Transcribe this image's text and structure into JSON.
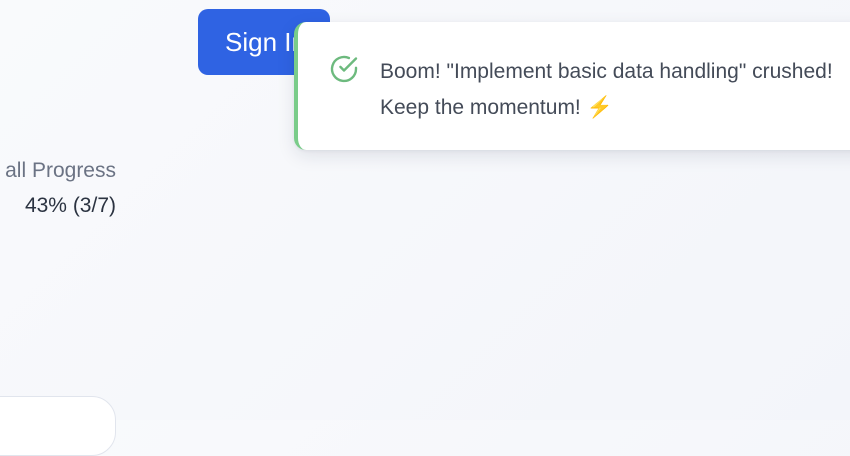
{
  "header": {
    "signin_label": "Sign In"
  },
  "progress": {
    "label": "all Progress",
    "value": "43% (3/7)"
  },
  "toast": {
    "message": "Boom! \"Implement basic data handling\" crushed! Keep the momentum! ",
    "emoji": "⚡",
    "icon": "check-circle-icon",
    "accent_color": "#7acc8a"
  },
  "colors": {
    "primary": "#2f63e3",
    "success": "#7acc8a"
  }
}
